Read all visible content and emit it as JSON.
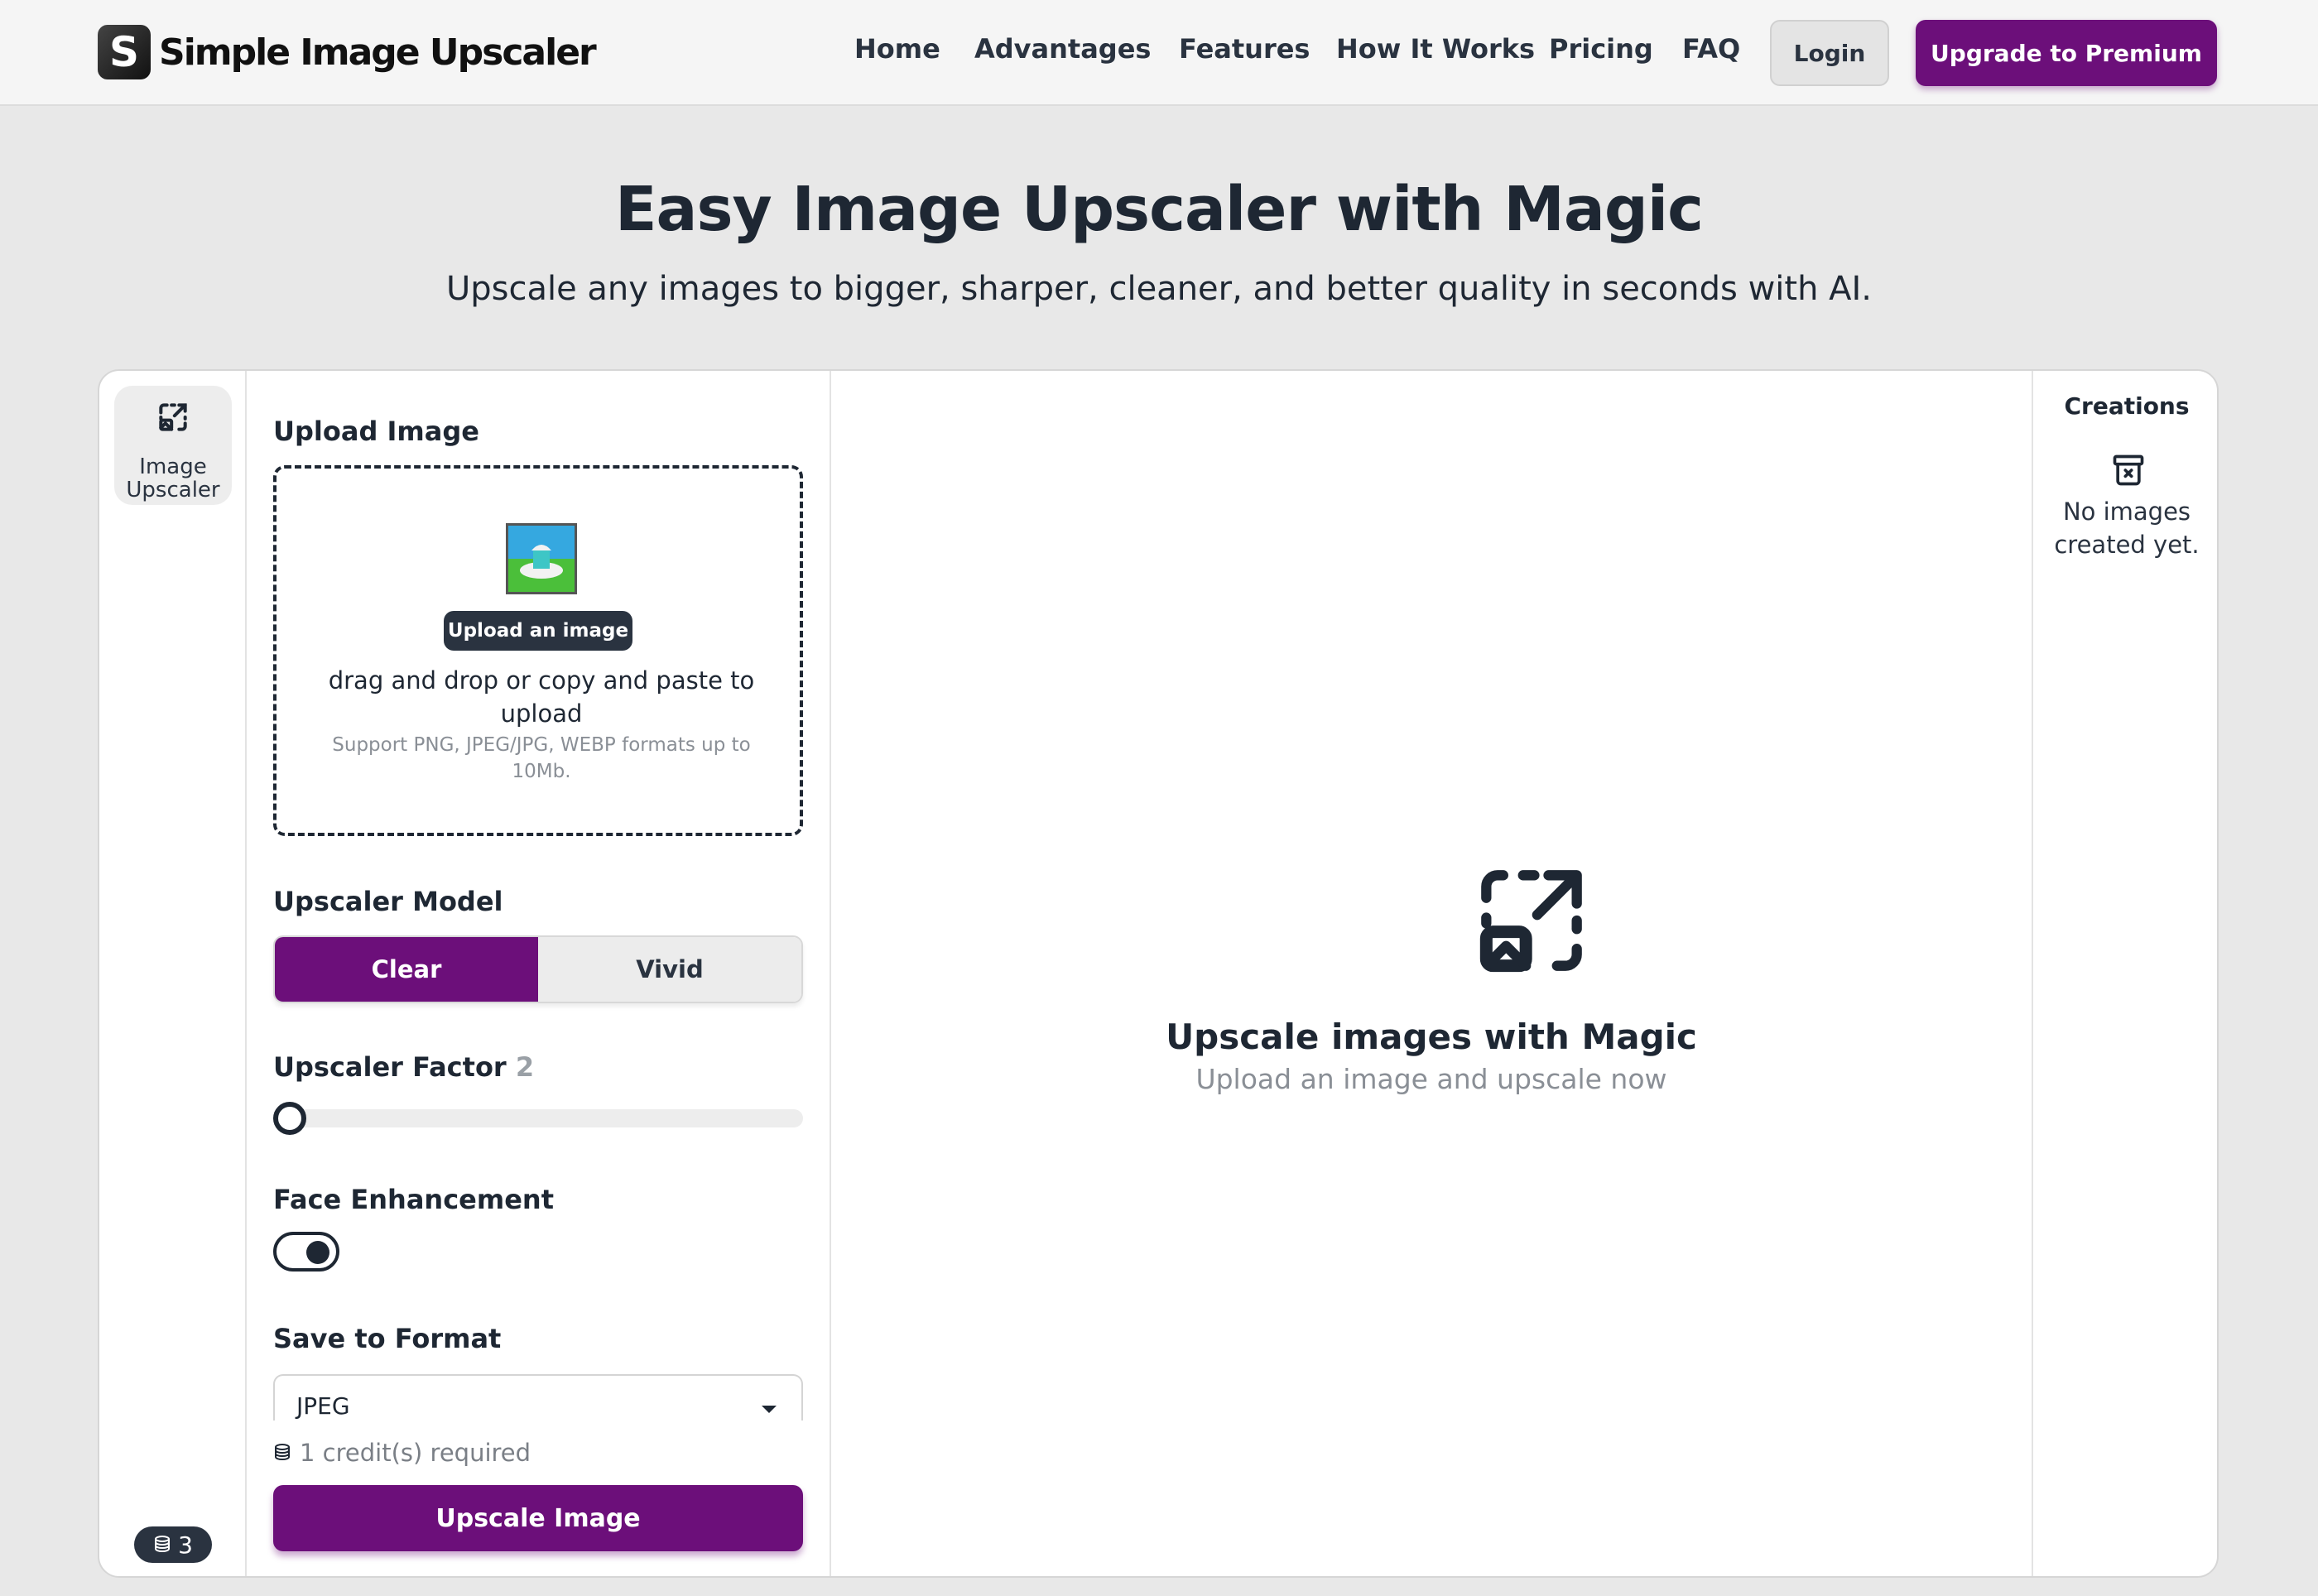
{
  "brand": {
    "logo_letter": "S",
    "name": "Simple Image Upscaler"
  },
  "nav": {
    "items": [
      "Home",
      "Advantages",
      "Features",
      "How It Works",
      "Pricing",
      "FAQ"
    ],
    "login": "Login",
    "premium": "Upgrade to Premium"
  },
  "hero": {
    "title": "Easy Image Upscaler with Magic",
    "subtitle": "Upscale any images to bigger, sharper, cleaner, and better quality in seconds with AI."
  },
  "rail": {
    "tool_label": "Image Upscaler",
    "credits": "3"
  },
  "upload": {
    "label": "Upload Image",
    "badge": "Upload an image",
    "instruction": "drag and drop or copy and paste to upload",
    "hint": "Support PNG, JPEG/JPG, WEBP formats up to 10Mb."
  },
  "model": {
    "label": "Upscaler Model",
    "options": [
      "Clear",
      "Vivid"
    ],
    "selected": "Clear"
  },
  "factor": {
    "label": "Upscaler Factor",
    "value": "2",
    "slider_level": 0.0
  },
  "face": {
    "label": "Face Enhancement",
    "enabled": true
  },
  "format": {
    "label": "Save to Format",
    "value": "JPEG"
  },
  "credits_required": "1 credit(s) required",
  "action": {
    "upscale": "Upscale Image"
  },
  "preview": {
    "title": "Upscale images with Magic",
    "subtitle": "Upload an image and upscale now"
  },
  "creations": {
    "title": "Creations",
    "empty": "No images created yet."
  },
  "colors": {
    "accent": "#6c0f7a",
    "text": "#1e2733",
    "muted": "#8a8f96",
    "background": "#e8e8e8"
  },
  "icons": {
    "logo": "logo-mark",
    "rail_tool": "upscale-icon",
    "coins": "coins-icon",
    "upload_thumb": "image-thumbnail-icon",
    "preview": "upscale-icon",
    "creations_empty": "archive-x-icon"
  }
}
